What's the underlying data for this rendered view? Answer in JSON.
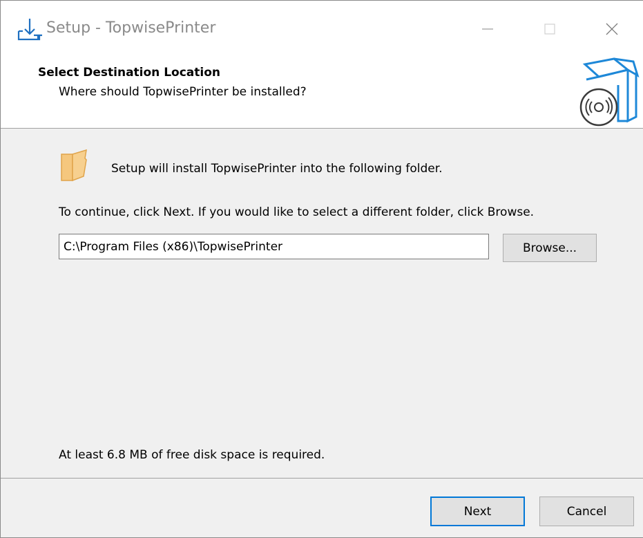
{
  "window": {
    "title": "Setup - TopwisePrinter",
    "app_icon": "install-arrow-icon",
    "controls": {
      "minimize_icon": "minimize-icon",
      "maximize_icon": "maximize-icon",
      "close_icon": "close-icon"
    }
  },
  "header": {
    "title": "Select Destination Location",
    "subtitle": "Where should TopwisePrinter be installed?",
    "icon": "software-box-disc-icon"
  },
  "body": {
    "folder_icon": "folder-icon",
    "install_text": "Setup will install TopwisePrinter into the following folder.",
    "continue_text": "To continue, click Next. If you would like to select a different folder, click Browse.",
    "path_value": "C:\\Program Files (x86)\\TopwisePrinter",
    "browse_label": "Browse...",
    "disk_space_text": "At least 6.8 MB of free disk space is required."
  },
  "footer": {
    "next_label": "Next",
    "cancel_label": "Cancel"
  },
  "colors": {
    "accent": "#0078d7",
    "folder": "#f5c77e",
    "box_icon": "#1e88d8"
  }
}
